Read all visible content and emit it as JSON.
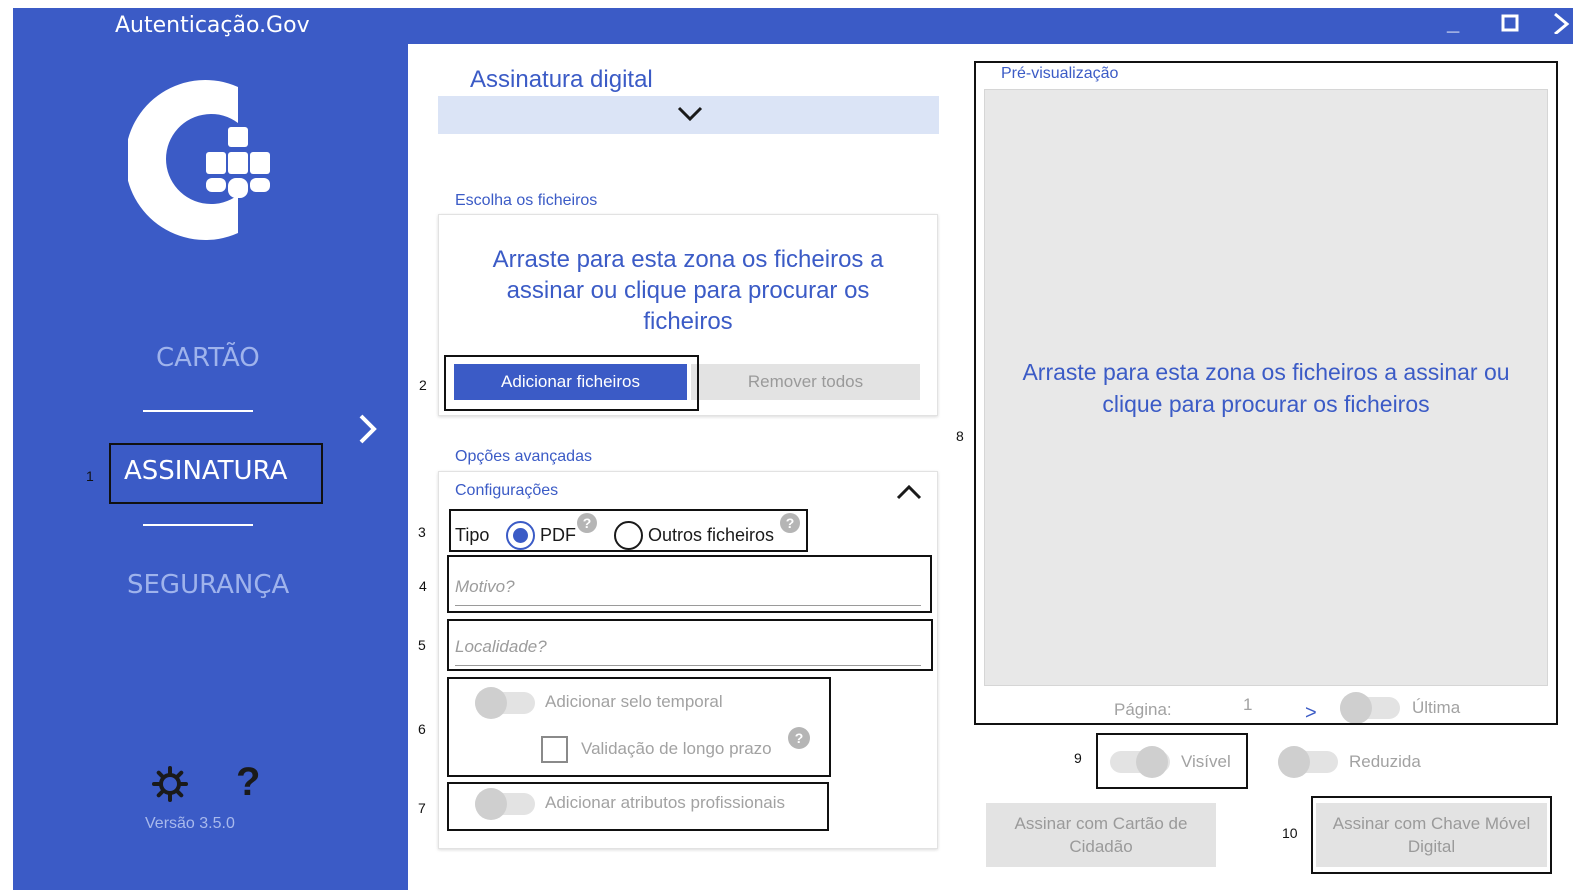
{
  "window": {
    "title": "Autenticação.Gov",
    "minimize_glyph": "_",
    "maximize_glyph": "□",
    "close_glyph": "✕"
  },
  "sidebar": {
    "items": [
      {
        "label": "CARTÃO"
      },
      {
        "label": "ASSINATURA"
      },
      {
        "label": "SEGURANÇA"
      }
    ],
    "settings_icon": "gear-icon",
    "help_glyph": "?",
    "version": "Versão 3.5.0"
  },
  "main": {
    "title": "Assinatura digital",
    "files": {
      "section_title": "Escolha os ficheiros",
      "dropzone_text": "Arraste para esta zona os ficheiros a assinar ou clique para procurar os ficheiros",
      "add_button": "Adicionar ficheiros",
      "remove_button": "Remover todos"
    },
    "advanced": {
      "section_title": "Opções avançadas",
      "config_title": "Configurações",
      "type_label": "Tipo",
      "type_options": [
        "PDF",
        "Outros ficheiros"
      ],
      "type_selected": "PDF",
      "motivo_placeholder": "Motivo?",
      "localidade_placeholder": "Localidade?",
      "timestamp_label": "Adicionar selo temporal",
      "timestamp_on": false,
      "long_term_label": "Validação de longo prazo",
      "long_term_checked": false,
      "professional_label": "Adicionar atributos profissionais",
      "professional_on": false
    }
  },
  "preview": {
    "title": "Pré-visualização",
    "dropzone_text": "Arraste para esta zona os ficheiros a assinar ou clique para procurar os ficheiros",
    "page_label": "Página:",
    "page_value": "1",
    "next_glyph": ">",
    "last_label": "Última",
    "last_on": false,
    "visible_label": "Visível",
    "visible_on": false,
    "reduced_label": "Reduzida",
    "reduced_on": false
  },
  "actions": {
    "sign_card": "Assinar com Cartão de Cidadão",
    "sign_cmd": "Assinar com Chave Móvel Digital"
  },
  "annotations": [
    "1",
    "2",
    "3",
    "4",
    "5",
    "6",
    "7",
    "8",
    "9",
    "10"
  ],
  "colors": {
    "brand_blue": "#3b5bc6",
    "nav_inactive": "#9fb3ec",
    "disabled_gray": "#e3e3e3",
    "preview_gray": "#e8e8e8"
  }
}
